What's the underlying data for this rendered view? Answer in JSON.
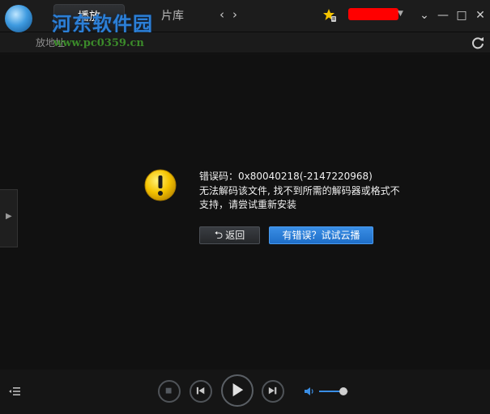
{
  "header": {
    "watermark": "河东软件园",
    "watermark_url": "www.pc0359.cn",
    "tabs": [
      {
        "label": "播放",
        "active": true
      },
      {
        "label": "片库",
        "active": false
      }
    ],
    "nav_back": "‹",
    "nav_forward": "›",
    "window_controls": {
      "menu": "⌄",
      "minimize": "—",
      "maximize": "□",
      "close": "✕"
    }
  },
  "address_bar": {
    "label": "放地址"
  },
  "error": {
    "code_line": "错误码：0x80040218(-2147220968)",
    "message_line1": "无法解码该文件, 找不到所需的解码器或格式不",
    "message_line2": "支持，请尝试重新安装",
    "back_label": "返回",
    "back_icon": "⮌",
    "cloud_label": "有错误？试试云播"
  },
  "player": {
    "volume": 0.82
  },
  "colors": {
    "accent": "#3a8ee5",
    "warning": "#f5c400",
    "account_redaction": "#ff0000"
  },
  "icons": [
    "app-logo-icon",
    "star-vip-icon",
    "refresh-icon",
    "warning-icon",
    "playlist-icon",
    "stop-icon",
    "previous-icon",
    "play-icon",
    "next-icon",
    "volume-icon"
  ]
}
